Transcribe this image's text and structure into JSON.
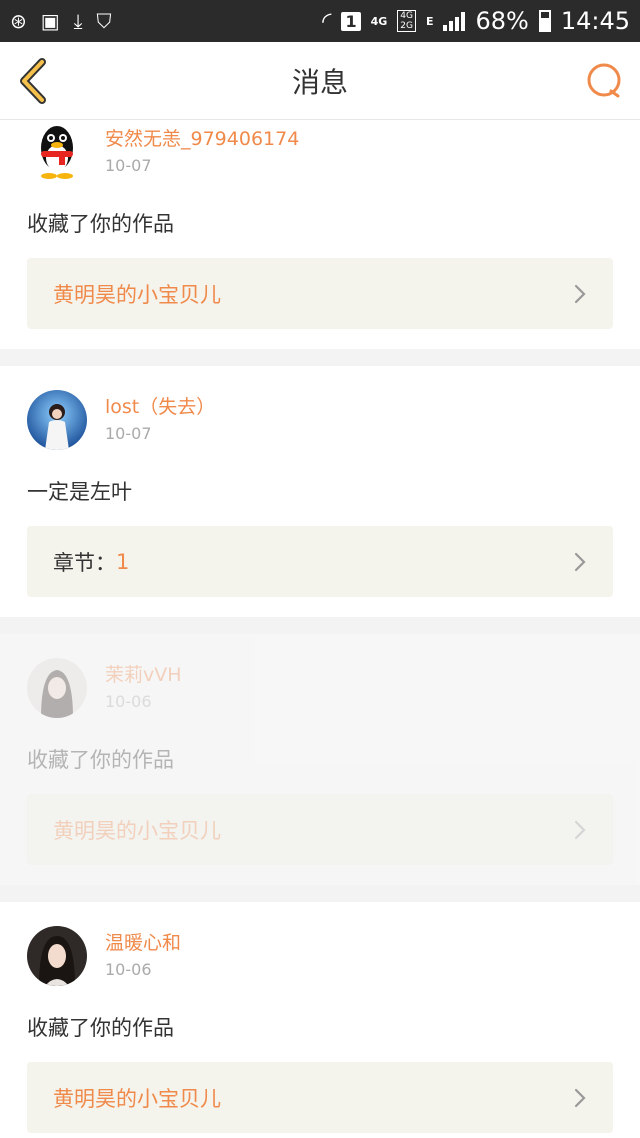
{
  "status_bar": {
    "battery": "68%",
    "time": "14:45",
    "sim": "1",
    "net1": "4G",
    "net2_top": "4G",
    "net2_bottom": "2G",
    "e_label": "E"
  },
  "header": {
    "title": "消息"
  },
  "messages": [
    {
      "name": "安然无恙_979406174",
      "date": "10-07",
      "text": "收藏了你的作品",
      "link_label": "黄明昊的小宝贝儿",
      "link_value": "",
      "avatar": "qq-penguin-avatar"
    },
    {
      "name": "lost（失去）",
      "date": "10-07",
      "text": "一定是左叶",
      "link_label": "章节：",
      "link_value": "1",
      "avatar": "stage-singer-avatar"
    },
    {
      "name": "茉莉vVH",
      "date": "10-06",
      "text": "收藏了你的作品",
      "link_label": "黄明昊的小宝贝儿",
      "link_value": "",
      "avatar": "girl-portrait-avatar"
    },
    {
      "name": "温暖心和",
      "date": "10-06",
      "text": "收藏了你的作品",
      "link_label": "黄明昊的小宝贝儿",
      "link_value": "",
      "avatar": "woman-portrait-avatar"
    }
  ],
  "colors": {
    "accent": "#f08a4b",
    "back_arrow": "#f5c14a",
    "link_bg": "#f4f3ec"
  }
}
